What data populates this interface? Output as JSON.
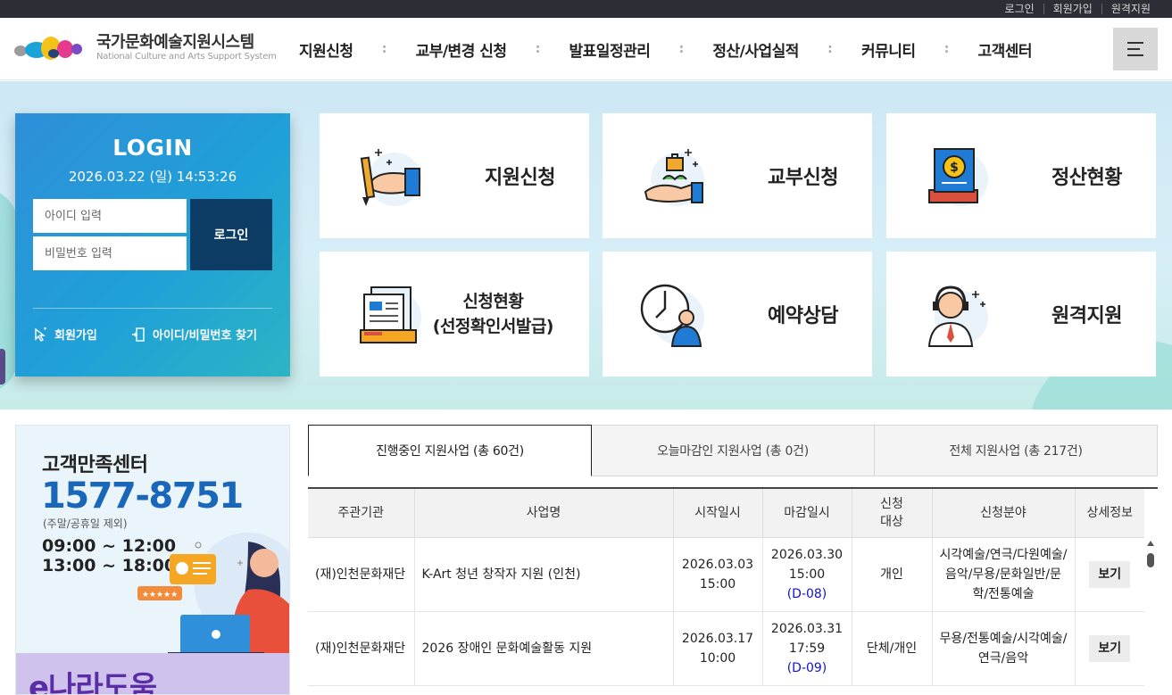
{
  "topbar": {
    "links": [
      "로그인",
      "회원가입",
      "원격지원"
    ]
  },
  "logo": {
    "title": "국가문화예술지원시스템",
    "subtitle": "National Culture and Arts Support System"
  },
  "gnb": {
    "items": [
      "지원신청",
      "교부/변경 신청",
      "발표일정관리",
      "정산/사업실적",
      "커뮤니티",
      "고객센터"
    ],
    "separator": ":"
  },
  "login": {
    "title": "LOGIN",
    "datetime": "2026.03.22 (일) 14:53:26",
    "id_placeholder": "아이디 입력",
    "pw_placeholder": "비밀번호 입력",
    "button": "로그인",
    "signup": "회원가입",
    "find": "아이디/비밀번호 찾기"
  },
  "quick_menu": [
    {
      "label": "지원신청",
      "icon": "hand-pencil-icon"
    },
    {
      "label": "교부신청",
      "icon": "hand-grant-icon"
    },
    {
      "label": "정산현황",
      "icon": "coin-ledger-icon"
    },
    {
      "label_line1": "신청현황",
      "label_line2": "(선정확인서발급)",
      "icon": "documents-icon"
    },
    {
      "label": "예약상담",
      "icon": "clock-person-icon"
    },
    {
      "label": "원격지원",
      "icon": "headset-agent-icon"
    }
  ],
  "customer_center": {
    "title": "고객만족센터",
    "phone": "1577-8751",
    "note": "(주말/공휴일 제외)",
    "hours_1": "09:00 ~ 12:00",
    "hours_2": "13:00 ~ 18:00",
    "banner": "e나라도움"
  },
  "tabs": [
    "진행중인 지원사업 (총 60건)",
    "오늘마감인 지원사업 (총 0건)",
    "전체 지원사업 (총 217건)"
  ],
  "table": {
    "headers": [
      "주관기관",
      "사업명",
      "시작일시",
      "마감일시",
      "신청\n대상",
      "신청분야",
      "상세정보"
    ],
    "rows": [
      {
        "org": "(재)인천문화재단",
        "name": "K-Art 청년 창작자 지원 (인천)",
        "start_date": "2026.03.03",
        "start_time": "15:00",
        "end_date": "2026.03.30",
        "end_time": "15:00",
        "dday": "(D-08)",
        "target": "개인",
        "field": "시각예술/연극/다원예술/음악/무용/문화일반/문학/전통예술",
        "detail": "보기"
      },
      {
        "org": "(재)인천문화재단",
        "name": "2026 장애인 문화예술활동 지원",
        "start_date": "2026.03.17",
        "start_time": "10:00",
        "end_date": "2026.03.31",
        "end_time": "17:59",
        "dday": "(D-09)",
        "target": "단체/개인",
        "field": "무용/전통예술/시각예술/연극/음악",
        "detail": "보기"
      }
    ]
  },
  "colors": {
    "login_bg": "#2f8fd8",
    "login_btn": "#0c3b63",
    "phone": "#1a66b8",
    "dday": "#1212d6"
  }
}
